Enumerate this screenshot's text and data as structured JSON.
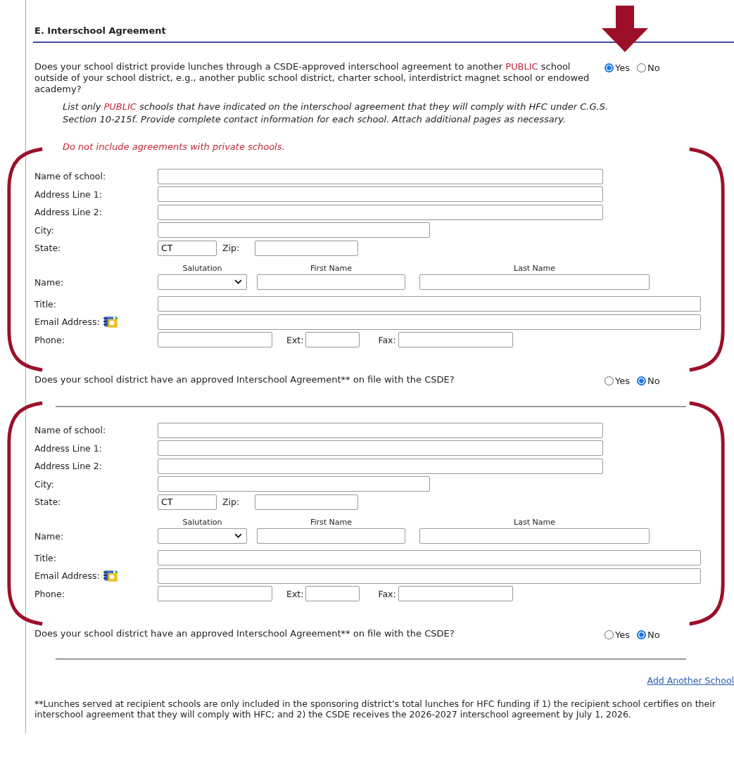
{
  "section_title": "E. Interschool Agreement",
  "question": {
    "parts": [
      {
        "text": "Does your school district provide lunches through a CSDE-approved interschool agreement to another ",
        "highlight": false
      },
      {
        "text": "PUBLIC",
        "highlight": true
      },
      {
        "text": " school outside of your school district, e.g., another public school district, charter school, interdistrict magnet school or endowed academy?",
        "highlight": false
      }
    ],
    "options": [
      {
        "label": "Yes",
        "selected": true
      },
      {
        "label": "No",
        "selected": false
      }
    ]
  },
  "instructions": {
    "parts": [
      {
        "text": "List only ",
        "highlight": false
      },
      {
        "text": "PUBLIC",
        "highlight": true
      },
      {
        "text": " schools that have indicated on the interschool agreement that they will comply with HFC under C.G.S. Section 10-215f. Provide complete contact information for each school. Attach additional pages as necessary.",
        "highlight": false
      }
    ]
  },
  "warning": "Do not include agreements with private schools.",
  "schools": [
    {
      "fields": [
        {
          "kind": "wide",
          "label": "Name of school:"
        },
        {
          "kind": "wide",
          "label": "Address Line 1:"
        },
        {
          "kind": "wide",
          "label": "Address Line 2:"
        },
        {
          "kind": "medium",
          "label": "City:"
        },
        {
          "kind": "state",
          "label": "State:",
          "value": "CT",
          "zip_label": "Zip:"
        },
        {
          "kind": "name",
          "label": "Name:",
          "headers": [
            "Salutation",
            "First Name",
            "Last Name"
          ]
        },
        {
          "kind": "full",
          "label": "Title:"
        },
        {
          "kind": "email",
          "label": "Email Address:"
        },
        {
          "kind": "phone",
          "label": "Phone:",
          "ext_label": "Ext:",
          "fax_label": "Fax:"
        }
      ],
      "agreement": {
        "text": "Does your school district have an approved Interschool Agreement** on file with the CSDE?",
        "options": [
          {
            "label": "Yes",
            "selected": false
          },
          {
            "label": "No",
            "selected": true
          }
        ]
      }
    },
    {
      "fields": [
        {
          "kind": "wide",
          "label": "Name of school:"
        },
        {
          "kind": "wide",
          "label": "Address Line 1:"
        },
        {
          "kind": "wide",
          "label": "Address Line 2:"
        },
        {
          "kind": "medium",
          "label": "City:"
        },
        {
          "kind": "state",
          "label": "State:",
          "value": "CT",
          "zip_label": "Zip:"
        },
        {
          "kind": "name",
          "label": "Name:",
          "headers": [
            "Salutation",
            "First Name",
            "Last Name"
          ]
        },
        {
          "kind": "full",
          "label": "Title:"
        },
        {
          "kind": "email",
          "label": "Email Address:"
        },
        {
          "kind": "phone",
          "label": "Phone:",
          "ext_label": "Ext:",
          "fax_label": "Fax:"
        }
      ],
      "agreement": {
        "text": "Does your school district have an approved Interschool Agreement** on file with the CSDE?",
        "options": [
          {
            "label": "Yes",
            "selected": false
          },
          {
            "label": "No",
            "selected": true
          }
        ]
      }
    }
  ],
  "add_link": "Add Another School",
  "footnote": "**Lunches served at recipient schools are only included in the sponsoring district’s total lunches for HFC funding if 1) the recipient school certifies on their interschool agreement that they will comply with HFC; and 2) the CSDE receives the 2026-2027 interschool agreement by July 1, 2026."
}
